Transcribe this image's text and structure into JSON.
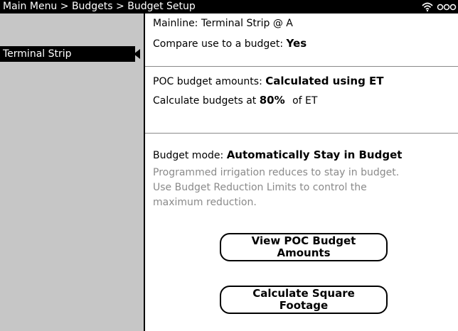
{
  "header": {
    "breadcrumb": "Main Menu > Budgets > Budget Setup",
    "wifi_icon": "wifi-icon",
    "battery_icon": "battery-icon"
  },
  "sidebar": {
    "selected_item": "Terminal Strip"
  },
  "main": {
    "mainline_label": "Mainline: Terminal Strip @ A",
    "compare_label": "Compare use to a budget:",
    "compare_value": "Yes",
    "poc_label": "POC budget amounts:",
    "poc_value": "Calculated using ET",
    "calc_prefix": "Calculate budgets at",
    "calc_value": "80%",
    "calc_suffix": "of ET",
    "mode_label": "Budget mode:",
    "mode_value": "Automatically Stay in Budget",
    "note_line1": "Programmed irrigation reduces to stay in budget.",
    "note_line2": "Use Budget Reduction Limits to control the",
    "note_line3": "maximum reduction.",
    "btn_view_poc": "View POC Budget Amounts",
    "btn_calc_sqft": "Calculate Square Footage"
  },
  "colors": {
    "sidebar_bg": "#c6c6c6",
    "header_bg": "#000000",
    "note_text": "#8a8a8a"
  }
}
